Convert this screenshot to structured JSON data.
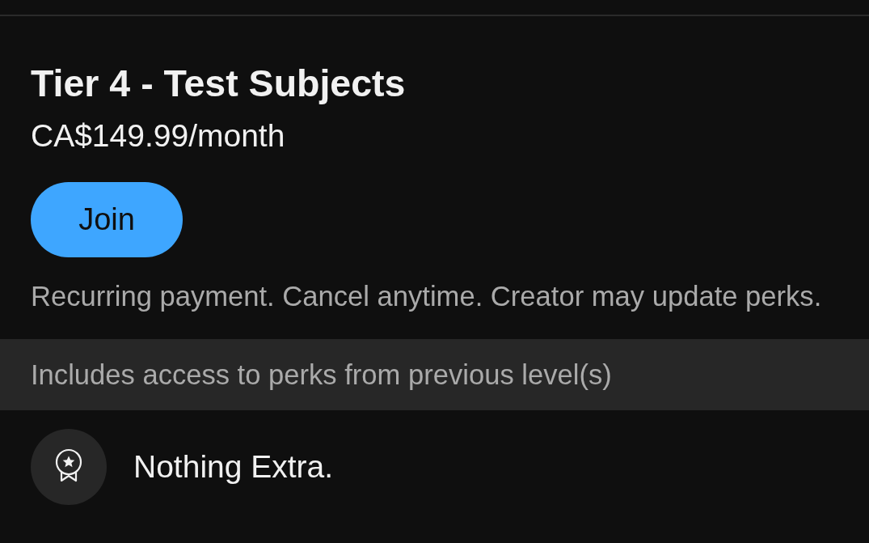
{
  "tier": {
    "title": "Tier 4 - Test Subjects",
    "price": "CA$149.99/month",
    "join_button": {
      "label": "Join"
    },
    "notice": "Recurring payment. Cancel anytime. Creator may update perks."
  },
  "includes_banner": "Includes access to perks from previous level(s)",
  "perks": [
    {
      "kind": "award",
      "label": "Nothing Extra."
    }
  ]
}
